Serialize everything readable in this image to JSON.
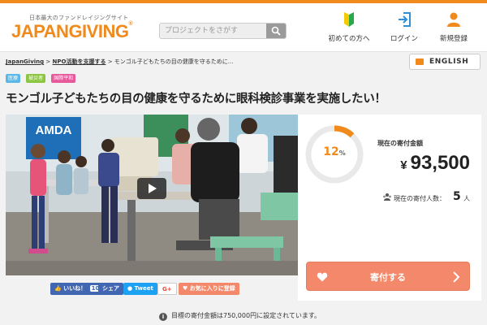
{
  "header": {
    "tagline": "日本最大のファンドレイジングサイト",
    "logo_text": "JAPANGIVING",
    "logo_reg": "®",
    "search": {
      "placeholder": "プロジェクトをさがす"
    },
    "nav": [
      {
        "label": "初めての方へ",
        "icon": "beginner-mark-icon"
      },
      {
        "label": "ログイン",
        "icon": "login-icon"
      },
      {
        "label": "新規登録",
        "icon": "user-icon"
      }
    ]
  },
  "breadcrumb": {
    "home": "JapanGiving",
    "category": "NPO活動を支援する",
    "sep": ">",
    "current": "モンゴル子どもたちの目の健康を守るために..."
  },
  "english_button": "ENGLISH",
  "tags": [
    {
      "label": "医療",
      "color": "#5bb8e6"
    },
    {
      "label": "被災者",
      "color": "#8cc63f"
    },
    {
      "label": "国際平和",
      "color": "#e65a9c"
    }
  ],
  "title": "モンゴル子どもたちの目の健康を守るために眼科検診事業を実施したい！",
  "photo": {
    "banner_text": "AMDA"
  },
  "stats": {
    "progress_percent": 12,
    "progress_unit": "%",
    "amount_label": "現在の寄付金額",
    "amount_currency": "¥",
    "amount_value": "93,500",
    "supporters_label": "現在の寄付人数：",
    "supporters_count": "5",
    "supporters_unit": "人"
  },
  "donate_button": "寄付する",
  "share": {
    "like": "いいね！",
    "like_count": "103",
    "share": "シェア",
    "tweet": "Tweet",
    "gplus": "G+",
    "favorite": "お気に入りに登録"
  },
  "footer_note": "目標の寄付金額は750,000円に設定されています。",
  "colors": {
    "accent": "#f08a1c",
    "donate": "#f3886a",
    "facebook": "#4267b2",
    "twitter": "#1da1f2",
    "gplus": "#dd4b39"
  }
}
